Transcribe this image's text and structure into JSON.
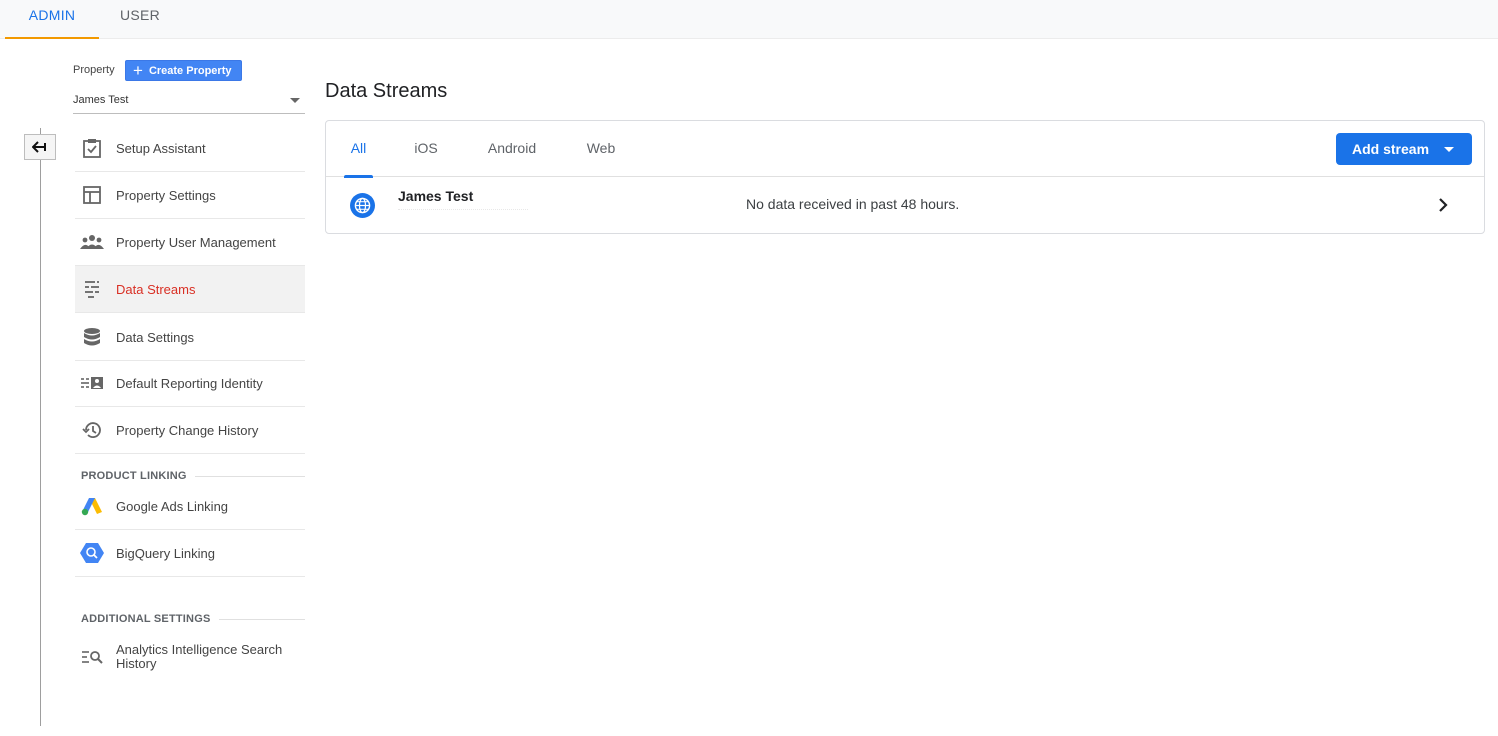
{
  "top_tabs": [
    {
      "label": "ADMIN",
      "active": true
    },
    {
      "label": "USER",
      "active": false
    }
  ],
  "property": {
    "label": "Property",
    "create_button": "Create Property",
    "selected": "James Test"
  },
  "nav": {
    "items": [
      {
        "label": "Setup Assistant",
        "icon": "clipboard-check-icon"
      },
      {
        "label": "Property Settings",
        "icon": "layout-icon"
      },
      {
        "label": "Property User Management",
        "icon": "people-icon"
      },
      {
        "label": "Data Streams",
        "icon": "data-streams-icon",
        "active": true
      },
      {
        "label": "Data Settings",
        "icon": "database-icon"
      },
      {
        "label": "Default Reporting Identity",
        "icon": "reporting-identity-icon"
      },
      {
        "label": "Property Change History",
        "icon": "history-icon"
      }
    ],
    "product_linking_heading": "PRODUCT LINKING",
    "product_linking": [
      {
        "label": "Google Ads Linking",
        "icon": "google-ads-icon"
      },
      {
        "label": "BigQuery Linking",
        "icon": "bigquery-icon"
      }
    ],
    "additional_settings_heading": "ADDITIONAL SETTINGS",
    "additional_settings": [
      {
        "label": "Analytics Intelligence Search History",
        "icon": "search-history-icon"
      }
    ]
  },
  "main": {
    "title": "Data Streams",
    "tabs": [
      "All",
      "iOS",
      "Android",
      "Web"
    ],
    "active_tab": "All",
    "add_stream_label": "Add stream",
    "streams": [
      {
        "name": "James Test",
        "status": "No data received in past 48 hours.",
        "icon": "globe-icon"
      }
    ]
  },
  "colors": {
    "accent_blue": "#1a73e8",
    "active_nav_text": "#d93025",
    "admin_tab_underline": "#f29900"
  }
}
